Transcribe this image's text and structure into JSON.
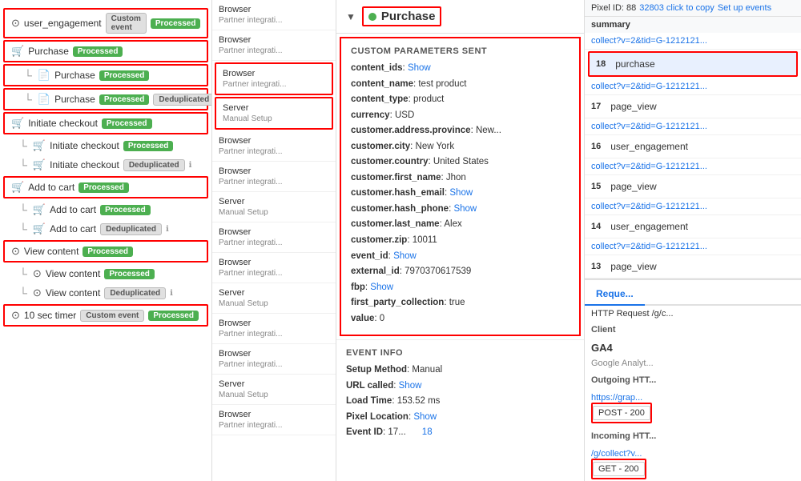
{
  "leftPanel": {
    "events": [
      {
        "id": "user_engagement",
        "icon": "⊙",
        "name": "user_engagement",
        "badge": "Custom event",
        "status": "Processed",
        "highlighted": true,
        "children": []
      },
      {
        "id": "purchase_main",
        "icon": "🛒",
        "name": "Purchase",
        "badge": "",
        "status": "Processed",
        "highlighted": true,
        "children": [
          {
            "icon": "📄",
            "name": "Purchase",
            "status": "Processed",
            "dedup": false
          },
          {
            "icon": "📄",
            "name": "Purchase",
            "status": "Processed",
            "dedup": true,
            "dedupLabel": "Deduplicated"
          }
        ]
      },
      {
        "id": "initiate_checkout",
        "icon": "🛒",
        "name": "Initiate checkout",
        "status": "Processed",
        "highlighted": true,
        "children": [
          {
            "icon": "🛒",
            "name": "Initiate checkout",
            "status": "Processed",
            "dedup": false
          },
          {
            "icon": "🛒",
            "name": "Initiate checkout",
            "status": "",
            "dedup": true,
            "dedupLabel": "Deduplicated"
          }
        ]
      },
      {
        "id": "add_to_cart",
        "icon": "🛒",
        "name": "Add to cart",
        "status": "Processed",
        "highlighted": true,
        "children": [
          {
            "icon": "🛒",
            "name": "Add to cart",
            "status": "Processed",
            "dedup": false
          },
          {
            "icon": "🛒",
            "name": "Add to cart",
            "status": "",
            "dedup": true,
            "dedupLabel": "Deduplicated"
          }
        ]
      },
      {
        "id": "view_content",
        "icon": "⊙",
        "name": "View content",
        "status": "Processed",
        "highlighted": true,
        "children": [
          {
            "icon": "⊙",
            "name": "View content",
            "status": "Processed",
            "dedup": false
          },
          {
            "icon": "⊙",
            "name": "View content",
            "status": "",
            "dedup": true,
            "dedupLabel": "Deduplicated"
          }
        ]
      },
      {
        "id": "ten_sec_timer",
        "icon": "⊙",
        "name": "10 sec timer",
        "badge": "Custom event",
        "status": "Processed",
        "highlighted": true,
        "children": []
      }
    ]
  },
  "middlePanel": {
    "rows": [
      {
        "type": "Browser",
        "sub": "Partner integrati...",
        "highlighted": false
      },
      {
        "type": "Browser",
        "sub": "Partner integrati...",
        "highlighted": false
      },
      {
        "type": "Browser",
        "sub": "Partner integrati...",
        "highlighted": true
      },
      {
        "type": "Server",
        "sub": "Manual Setup",
        "highlighted": true
      },
      {
        "type": "Browser",
        "sub": "Partner integrati...",
        "highlighted": false
      },
      {
        "type": "Browser",
        "sub": "Partner integrati...",
        "highlighted": false
      },
      {
        "type": "Server",
        "sub": "Manual Setup",
        "highlighted": false
      },
      {
        "type": "Browser",
        "sub": "Partner integrati...",
        "highlighted": false
      },
      {
        "type": "Browser",
        "sub": "Partner integrati...",
        "highlighted": false
      },
      {
        "type": "Server",
        "sub": "Manual Setup",
        "highlighted": false
      },
      {
        "type": "Browser",
        "sub": "Partner integrati...",
        "highlighted": false
      },
      {
        "type": "Browser",
        "sub": "Partner integrati...",
        "highlighted": false
      },
      {
        "type": "Server",
        "sub": "Manual Setup",
        "highlighted": false
      },
      {
        "type": "Browser",
        "sub": "Partner integrati...",
        "highlighted": false
      }
    ]
  },
  "purchaseHeader": {
    "title": "Purchase"
  },
  "customParams": {
    "sectionTitle": "CUSTOM PARAMETERS SENT",
    "params": [
      {
        "key": "content_ids",
        "value": "",
        "link": "Show"
      },
      {
        "key": "content_name",
        "value": "test product",
        "link": ""
      },
      {
        "key": "content_type",
        "value": "product",
        "link": ""
      },
      {
        "key": "currency",
        "value": "USD",
        "link": ""
      },
      {
        "key": "customer.address.province",
        "value": "New...",
        "link": ""
      },
      {
        "key": "customer.city",
        "value": "New York",
        "link": ""
      },
      {
        "key": "customer.country",
        "value": "United States",
        "link": ""
      },
      {
        "key": "customer.first_name",
        "value": "Jhon",
        "link": ""
      },
      {
        "key": "customer.hash_email",
        "value": "",
        "link": "Show"
      },
      {
        "key": "customer.hash_phone",
        "value": "",
        "link": "Show"
      },
      {
        "key": "customer.last_name",
        "value": "Alex",
        "link": ""
      },
      {
        "key": "customer.zip",
        "value": "10011",
        "link": ""
      },
      {
        "key": "event_id",
        "value": "",
        "link": "Show"
      },
      {
        "key": "external_id",
        "value": "7970370617539",
        "link": ""
      },
      {
        "key": "fbp",
        "value": "",
        "link": "Show"
      },
      {
        "key": "first_party_collection",
        "value": "true",
        "link": ""
      },
      {
        "key": "value",
        "value": "0",
        "link": ""
      }
    ]
  },
  "eventInfo": {
    "sectionTitle": "EVENT INFO",
    "rows": [
      {
        "key": "Setup Method",
        "value": "Manual"
      },
      {
        "key": "URL called",
        "value": "",
        "link": "Show"
      },
      {
        "key": "Load Time",
        "value": "153.52 ms"
      },
      {
        "key": "Pixel Location",
        "value": "",
        "link": "Show"
      },
      {
        "key": "Event ID",
        "value": "17..."
      }
    ]
  },
  "rightPanel": {
    "pixelId": "Pixel ID: 88",
    "pixelIdNum": "32803",
    "pixelCopy": "click to copy",
    "setupLink": "Set up events",
    "tabs": [
      "Reque"
    ],
    "summary": "summary",
    "networkEntries": [
      {
        "url": "collect?v=2&tid=G-1212121...",
        "number": "",
        "eventName": "",
        "highlighted": false
      },
      {
        "url": "",
        "number": "18",
        "eventName": "purchase",
        "highlighted": true
      },
      {
        "url": "collect?v=2&tid=G-1212121...",
        "number": "",
        "eventName": "",
        "highlighted": false
      },
      {
        "url": "",
        "number": "17",
        "eventName": "page_view",
        "highlighted": false
      },
      {
        "url": "collect?v=2&tid=G-1212121...",
        "number": "",
        "eventName": "",
        "highlighted": false
      },
      {
        "url": "",
        "number": "16",
        "eventName": "user_engagement",
        "highlighted": false
      },
      {
        "url": "collect?v=2&tid=G-1212121...",
        "number": "",
        "eventName": "",
        "highlighted": false
      },
      {
        "url": "",
        "number": "15",
        "eventName": "page_view",
        "highlighted": false
      },
      {
        "url": "collect?v=2&tid=G-1212121...",
        "number": "",
        "eventName": "",
        "highlighted": false
      },
      {
        "url": "",
        "number": "14",
        "eventName": "user_engagement",
        "highlighted": false
      },
      {
        "url": "collect?v=2&tid=G-1212121...",
        "number": "",
        "eventName": "",
        "highlighted": false
      },
      {
        "url": "",
        "number": "13",
        "eventName": "page_view",
        "highlighted": false
      }
    ],
    "httpRequest": "HTTP Request /g/c...",
    "clientLabel": "Client",
    "clientName": "GA4",
    "clientSub": "Google Analyt...",
    "outgoingLabel": "Outgoing HTT...",
    "outgoingUrl": "https://grap...",
    "postMethod": "POST - 200",
    "incomingLabel": "Incoming HTT...",
    "incomingUrl": "/g/collect?v...",
    "getMethod": "GET - 200"
  }
}
